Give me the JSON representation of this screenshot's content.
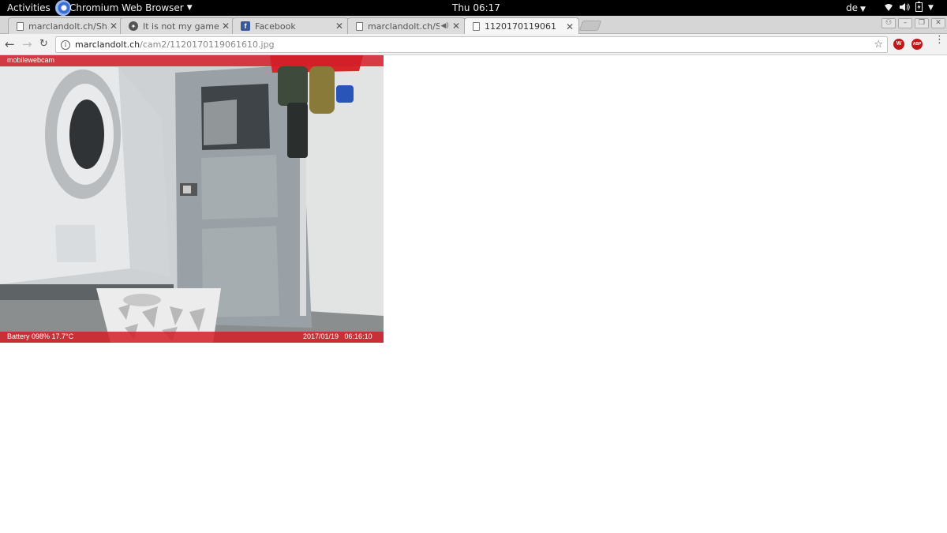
{
  "topbar": {
    "activities": "Activities",
    "app_name": "Chromium Web Browser",
    "clock": "Thu 06:17",
    "language": "de"
  },
  "tabs": [
    {
      "title": "marclandolt.ch/Shri",
      "icon": "document-icon"
    },
    {
      "title": "It is not my game, b",
      "icon": "game-icon"
    },
    {
      "title": "Facebook",
      "icon": "facebook-icon"
    },
    {
      "title": "marclandolt.ch/Sl",
      "icon": "document-icon",
      "audio": true
    },
    {
      "title": "1120170119061",
      "icon": "document-icon",
      "active": true
    }
  ],
  "address": {
    "host": "marclandolt.ch",
    "path": "/cam2/1120170119061610.jpg"
  },
  "extensions": [
    {
      "label": "W",
      "name": "w-extension-icon",
      "color": "#c01818"
    },
    {
      "label": "ABP",
      "name": "adblock-plus-icon",
      "color": "#c01818"
    }
  ],
  "image": {
    "top_caption": "mobilewebcam",
    "battery_caption": "Battery 098% 17.7°C",
    "timestamp_caption": "2017/01/19   06:16:10",
    "accent_color": "#d21e28"
  }
}
